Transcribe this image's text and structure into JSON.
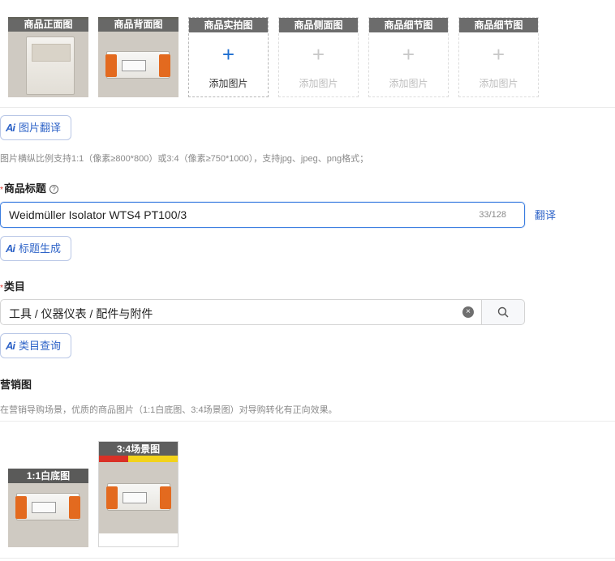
{
  "product_images": [
    {
      "caption": "商品正面图",
      "state": "filled"
    },
    {
      "caption": "商品背面图",
      "state": "filled"
    },
    {
      "caption": "商品实拍图",
      "state": "add",
      "add_label": "添加图片",
      "plus": "+"
    },
    {
      "caption": "商品侧面图",
      "state": "disabled",
      "add_label": "添加图片",
      "plus": "+"
    },
    {
      "caption": "商品细节图",
      "state": "disabled",
      "add_label": "添加图片",
      "plus": "+"
    },
    {
      "caption": "商品细节图",
      "state": "disabled",
      "add_label": "添加图片",
      "plus": "+"
    }
  ],
  "image_translate_button": {
    "ai": "Ai",
    "label": "图片翻译"
  },
  "image_hint": "图片横纵比例支持1:1（像素≥800*800）或3:4（像素≥750*1000），支持jpg、jpeg、png格式；",
  "title_field": {
    "required_mark": "*",
    "label": "商品标题",
    "help_icon": "?",
    "value": "Weidmüller Isolator WTS4 PT100/3",
    "count": "33/128",
    "translate_link": "翻译"
  },
  "title_generate_button": {
    "ai": "Ai",
    "label": "标题生成"
  },
  "category_field": {
    "required_mark": "*",
    "label": "类目",
    "value": "工具 / 仪器仪表 / 配件与附件",
    "clear_icon": "×"
  },
  "category_query_button": {
    "ai": "Ai",
    "label": "类目查询"
  },
  "marketing": {
    "label": "营销图",
    "hint": "在营销导购场景，优质的商品图片（1:1白底图、3:4场景图）对导购转化有正向效果。",
    "images": [
      {
        "caption": "1:1白底图"
      },
      {
        "caption": "3:4场景图"
      }
    ]
  },
  "colors": {
    "accent": "#2f64c8",
    "focus_border": "#3b7de0",
    "required": "#d93026"
  }
}
